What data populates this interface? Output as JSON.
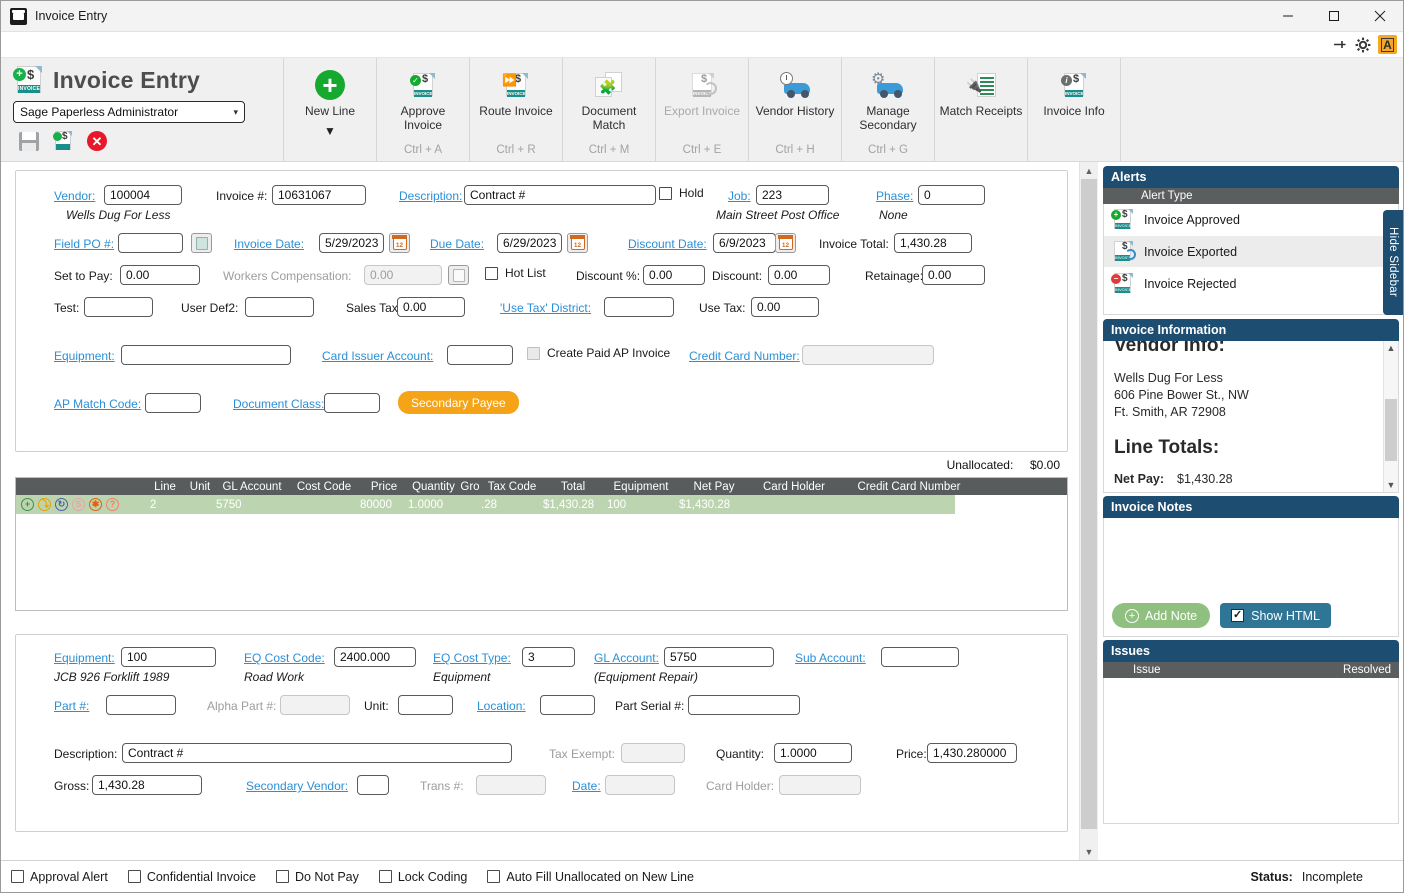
{
  "window": {
    "title": "Invoice Entry",
    "app_icon": "invoice-app-icon",
    "minimize": "—",
    "maximize": "□",
    "close": "✕"
  },
  "substrip": {
    "pin": "pin-icon",
    "gear": "gear-icon",
    "badge": "A"
  },
  "ribbon": {
    "title": "Invoice Entry",
    "user": "Sage Paperless Administrator",
    "chevron": "▾",
    "quick": [
      {
        "name": "save-icon",
        "label": "Save"
      },
      {
        "name": "save-invoice-icon",
        "label": "Save Invoice"
      },
      {
        "name": "cancel-icon",
        "label": "Cancel"
      }
    ],
    "items": [
      {
        "label": "New Line",
        "shortcut": "",
        "icon": "plus-circle-icon",
        "disabled": false,
        "caret": "▼"
      },
      {
        "label": "Approve\nInvoice",
        "shortcut": "Ctrl + A",
        "icon": "approve-invoice-icon",
        "disabled": false
      },
      {
        "label": "Route Invoice",
        "shortcut": "Ctrl + R",
        "icon": "route-invoice-icon",
        "disabled": false
      },
      {
        "label": "Document\nMatch",
        "shortcut": "Ctrl + M",
        "icon": "document-match-icon",
        "disabled": false
      },
      {
        "label": "Export Invoice",
        "shortcut": "Ctrl + E",
        "icon": "export-invoice-icon",
        "disabled": true
      },
      {
        "label": "Vendor History",
        "shortcut": "Ctrl + H",
        "icon": "vendor-history-icon",
        "disabled": false
      },
      {
        "label": "Manage\nSecondary",
        "shortcut": "Ctrl + G",
        "icon": "manage-secondary-icon",
        "disabled": false
      },
      {
        "label": "Match Receipts",
        "shortcut": "",
        "icon": "match-receipts-icon",
        "disabled": false
      },
      {
        "label": "Invoice Info",
        "shortcut": "",
        "icon": "invoice-info-icon",
        "disabled": false
      }
    ]
  },
  "header_form": {
    "vendor_label": "Vendor:",
    "vendor_value": "100004",
    "vendor_name": "Wells Dug For Less",
    "invoice_no_label": "Invoice #:",
    "invoice_no_value": "10631067",
    "description_label": "Description:",
    "description_value": "Contract #",
    "hold_label": "Hold",
    "job_label": "Job:",
    "job_value": "223",
    "job_name": "Main Street Post Office",
    "phase_label": "Phase:",
    "phase_value": "0",
    "phase_name": "None",
    "field_po_label": "Field PO #:",
    "field_po_value": "",
    "invoice_date_label": "Invoice Date:",
    "invoice_date_value": "5/29/2023",
    "due_date_label": "Due Date:",
    "due_date_value": "6/29/2023",
    "discount_date_label": "Discount Date:",
    "discount_date_value": "6/9/2023",
    "invoice_total_label": "Invoice Total:",
    "invoice_total_value": "1,430.28",
    "set_to_pay_label": "Set to Pay:",
    "set_to_pay_value": "0.00",
    "workers_comp_label": "Workers Compensation:",
    "workers_comp_value": "0.00",
    "hot_list_label": "Hot List",
    "discount_pct_label": "Discount %:",
    "discount_pct_value": "0.00",
    "discount_label": "Discount:",
    "discount_value": "0.00",
    "retainage_label": "Retainage:",
    "retainage_value": "0.00",
    "test_label": "Test:",
    "test_value": "",
    "user_def2_label": "User Def2:",
    "user_def2_value": "",
    "sales_tax_label": "Sales Tax:",
    "sales_tax_value": "0.00",
    "use_tax_district_label": "'Use Tax' District:",
    "use_tax_district_value": "",
    "use_tax_label": "Use Tax:",
    "use_tax_value": "0.00",
    "equipment_label": "Equipment:",
    "equipment_value": "",
    "card_issuer_label": "Card Issuer Account:",
    "card_issuer_value": "",
    "create_paid_label": "Create Paid AP Invoice",
    "credit_card_label": "Credit Card Number:",
    "credit_card_value": "",
    "ap_match_label": "AP Match Code:",
    "ap_match_value": "",
    "doc_class_label": "Document Class:",
    "doc_class_value": "",
    "secondary_payee_btn": "Secondary Payee"
  },
  "unallocated": {
    "label": "Unallocated:",
    "value": "$0.00"
  },
  "grid": {
    "columns": [
      "Line",
      "Unit",
      "GL Account",
      "Cost Code",
      "Price",
      "Quantity",
      "Gro",
      "Tax Code",
      "Total",
      "Equipment",
      "Net Pay",
      "Card Holder",
      "Credit Card Number"
    ],
    "rows": [
      {
        "Line": "2",
        "Unit": "",
        "GL Account": "5750",
        "Cost Code": "",
        "Price": "80000",
        "Quantity": "1.0000",
        "Gro": "",
        "Tax Code": ".28",
        "Total": "$1,430.28",
        "Equipment": "100",
        "Net Pay": "$1,430.28",
        "Card Holder": "",
        "Credit Card Number": ""
      }
    ],
    "row_actions": [
      "add-icon",
      "expand-icon",
      "refresh-icon",
      "split-icon",
      "delete-icon",
      "help-icon"
    ]
  },
  "detail_form": {
    "equipment_label": "Equipment:",
    "equipment_value": "100",
    "equipment_name": "JCB 926 Forklift 1989",
    "eq_cost_code_label": "EQ Cost Code:",
    "eq_cost_code_value": "2400.000",
    "eq_cost_code_name": "Road Work",
    "eq_cost_type_label": "EQ Cost Type:",
    "eq_cost_type_value": "3",
    "eq_cost_type_name": "Equipment",
    "gl_account_label": "GL Account:",
    "gl_account_value": "5750",
    "gl_account_name": "(Equipment Repair)",
    "sub_account_label": "Sub Account:",
    "sub_account_value": "",
    "part_label": "Part #:",
    "part_value": "",
    "alpha_part_label": "Alpha Part #:",
    "alpha_part_value": "",
    "unit_label": "Unit:",
    "unit_value": "",
    "location_label": "Location:",
    "location_value": "",
    "part_serial_label": "Part Serial #:",
    "part_serial_value": "",
    "description_label": "Description:",
    "description_value": "Contract #",
    "tax_exempt_label": "Tax Exempt:",
    "tax_exempt_value": "",
    "quantity_label": "Quantity:",
    "quantity_value": "1.0000",
    "price_label": "Price:",
    "price_value": "1,430.280000",
    "gross_label": "Gross:",
    "gross_value": "1,430.28",
    "secondary_vendor_label": "Secondary Vendor:",
    "secondary_vendor_value": "",
    "trans_label": "Trans #:",
    "trans_value": "",
    "date_label": "Date:",
    "date_value": "",
    "card_holder_label": "Card Holder:",
    "card_holder_value": ""
  },
  "sidebar": {
    "hide_sidebar_label": "Hide Sidebar",
    "alerts": {
      "title": "Alerts",
      "column": "Alert Type",
      "rows": [
        {
          "label": "Invoice Approved",
          "icon": "invoice-approved-icon",
          "selected": false
        },
        {
          "label": "Invoice Exported",
          "icon": "invoice-exported-icon",
          "selected": true
        },
        {
          "label": "Invoice Rejected",
          "icon": "invoice-rejected-icon",
          "selected": false
        }
      ]
    },
    "invoice_information": {
      "title": "Invoice Information",
      "vendor_heading": "Vendor Info:",
      "vendor_name": "Wells Dug For Less",
      "vendor_street": "606 Pine Bower St., NW",
      "vendor_city": "Ft. Smith, AR 72908",
      "line_totals_heading": "Line Totals:",
      "net_pay_label": "Net Pay:",
      "net_pay_value": "$1,430.28"
    },
    "invoice_notes": {
      "title": "Invoice Notes",
      "add_note_label": "Add Note",
      "show_html_label": "Show HTML",
      "show_html_checked": true
    },
    "issues": {
      "title": "Issues",
      "col_issue": "Issue",
      "col_resolved": "Resolved"
    }
  },
  "statusbar": {
    "checkboxes": [
      {
        "label": "Approval Alert",
        "checked": false
      },
      {
        "label": "Confidential Invoice",
        "checked": false
      },
      {
        "label": "Do Not Pay",
        "checked": false
      },
      {
        "label": "Lock Coding",
        "checked": false
      },
      {
        "label": "Auto Fill Unallocated on New Line",
        "checked": false
      }
    ],
    "status_label": "Status:",
    "status_value": "Incomplete"
  },
  "colors": {
    "accent_navy": "#1d4e72",
    "grid_header": "#585c5c",
    "grid_row": "#bcd5b0",
    "link_blue": "#2b8fd6",
    "orange": "#f5a317",
    "green": "#16a92f"
  }
}
